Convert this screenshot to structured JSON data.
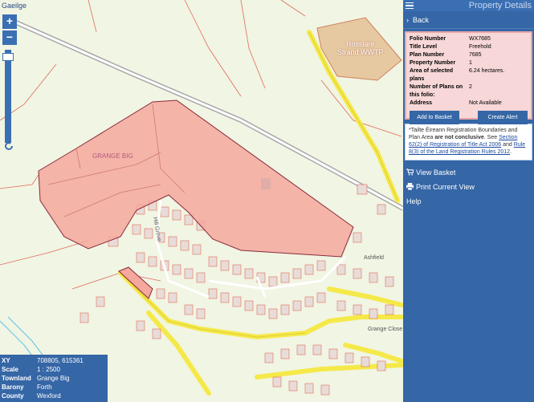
{
  "map": {
    "lang_link": "Gaeilge",
    "zoom_in": "+",
    "zoom_out": "−",
    "refresh_icon": "refresh-icon",
    "labels": {
      "parcel": "GRANGE BIG",
      "wwtp_line1": "Rosslare",
      "wwtp_line2": "Strand WWTP",
      "road1": "Hill Grove",
      "road2": "Ashfield",
      "road3": "Grange Close"
    },
    "colors": {
      "parcel_fill": "#f4a89e",
      "parcel_stroke": "#8a2a3a",
      "road": "#f5e94a",
      "boundary": "#e06b5a",
      "water": "#6ec8e8",
      "background": "#f1f5e3"
    }
  },
  "info": {
    "rows": [
      {
        "key": "XY",
        "value": "708805, 615361"
      },
      {
        "key": "Scale",
        "value": "1 : 2500"
      },
      {
        "key": "Townland",
        "value": "Grange Big"
      },
      {
        "key": "Barony",
        "value": "Forth"
      },
      {
        "key": "County",
        "value": "Wexford"
      }
    ]
  },
  "panel": {
    "title": "Property Details",
    "back": "Back",
    "details": [
      {
        "key": "Folio Number",
        "value": "WX7685"
      },
      {
        "key": "Title Level",
        "value": "Freehold"
      },
      {
        "key": "Plan Number",
        "value": "7685"
      },
      {
        "key": "Property Number",
        "value": "1"
      },
      {
        "key": "Area of selected plans",
        "value": "6.24 hectares."
      },
      {
        "key": "Number of Plans on this folio:",
        "value": "2"
      },
      {
        "key": "Address",
        "value": "Not Available"
      }
    ],
    "add_to_basket": "Add to Basket",
    "create_alert": "Create Alert",
    "note": {
      "part1": "*Tailte Éireann Registration Boundaries and Plan Area ",
      "bold": "are not conclusive",
      "part2": ". See ",
      "link1": "Section 62(2) of Registration of Title Act 2006",
      "part3": " and ",
      "link2": "Rule 8(3) of the Land Registration Rules 2012",
      "part4": "."
    },
    "view_basket": "View Basket",
    "print_view": "Print Current View",
    "help": "Help"
  }
}
